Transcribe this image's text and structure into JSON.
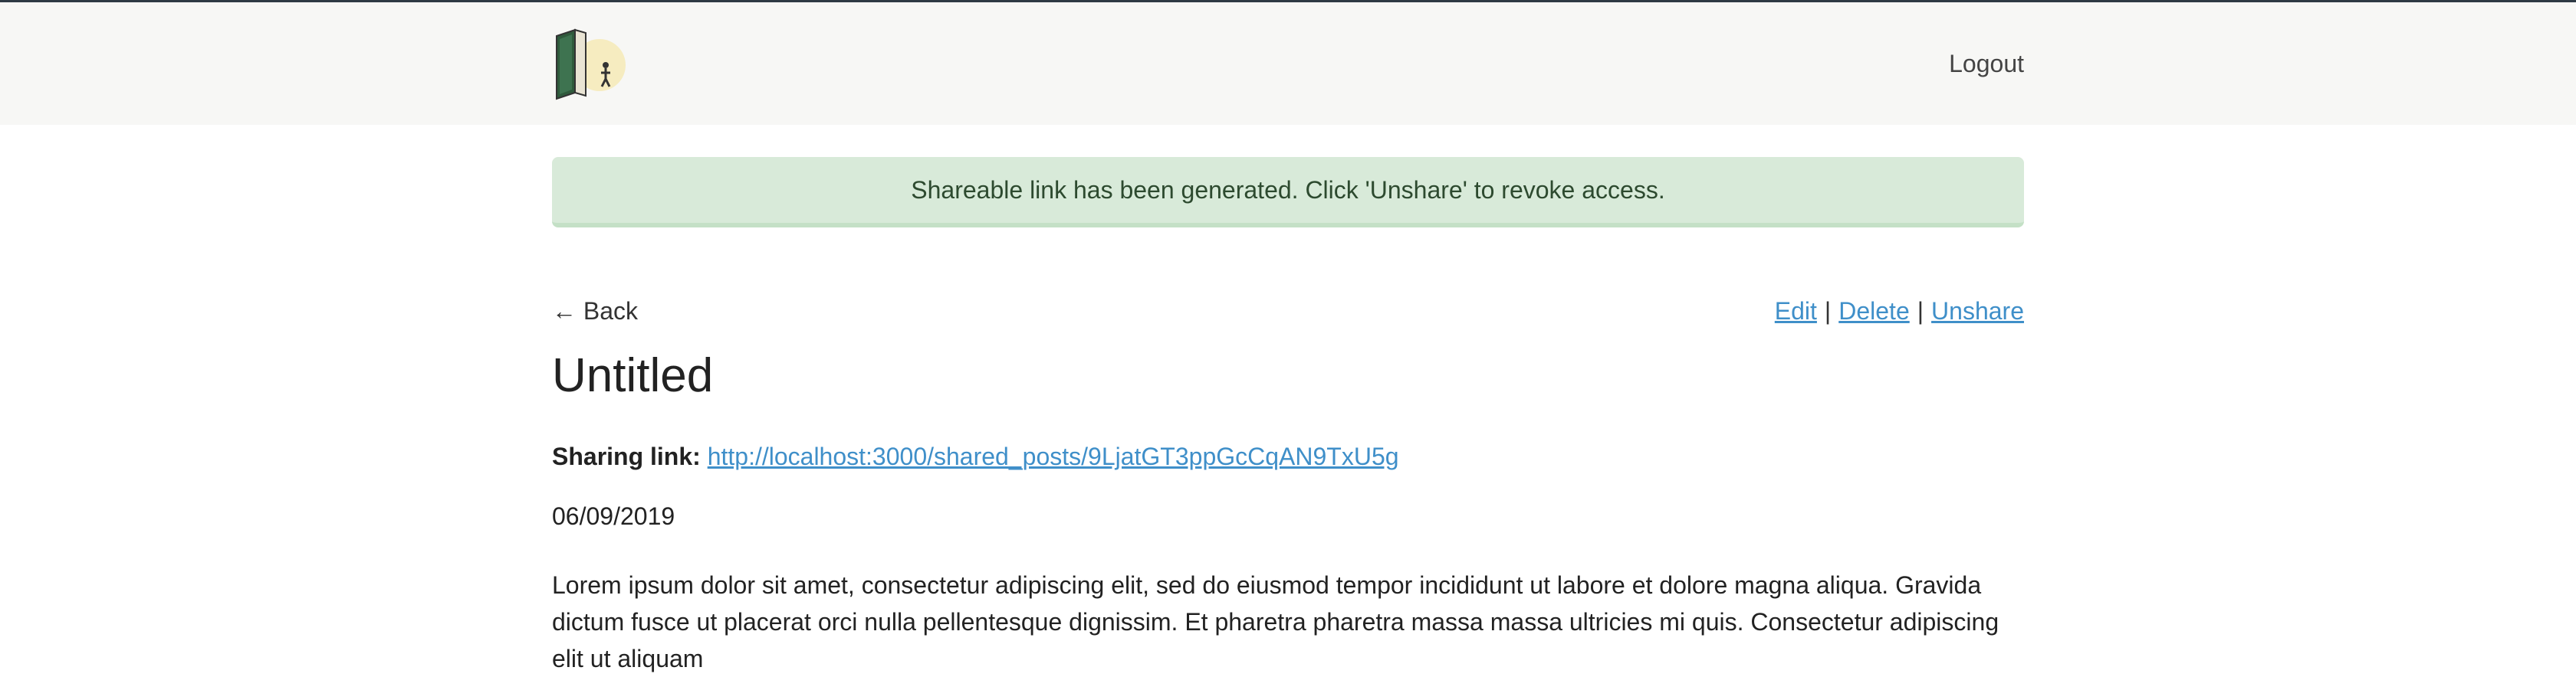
{
  "header": {
    "logout_label": "Logout"
  },
  "alert": {
    "message": "Shareable link has been generated. Click 'Unshare' to revoke access."
  },
  "post_nav": {
    "back_label": "← Back",
    "edit_label": "Edit",
    "delete_label": "Delete",
    "unshare_label": "Unshare",
    "separator": "|"
  },
  "post": {
    "title": "Untitled",
    "sharing_label": "Sharing link:",
    "sharing_url": "http://localhost:3000/shared_posts/9LjatGT3ppGcCqAN9TxU5g",
    "date": "06/09/2019",
    "body": "Lorem ipsum dolor sit amet, consectetur adipiscing elit, sed do eiusmod tempor incididunt ut labore et dolore magna aliqua. Gravida dictum fusce ut placerat orci nulla pellentesque dignissim. Et pharetra pharetra massa massa ultricies mi quis. Consectetur adipiscing elit ut aliquam"
  },
  "colors": {
    "link": "#3f8fc9",
    "alert_bg": "#d8ead9",
    "navbar_bg": "#f7f7f5"
  },
  "icons": {
    "logo": "book-door-logo-icon"
  }
}
